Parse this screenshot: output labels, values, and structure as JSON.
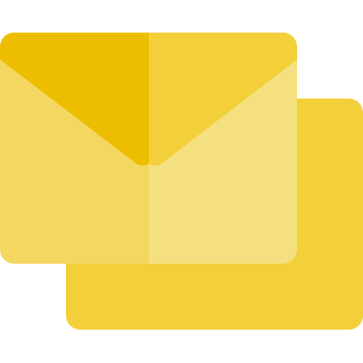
{
  "icon": {
    "name": "mail-envelopes-icon",
    "colors": {
      "back_envelope": "#F3D03A",
      "front_body_left": "#F4D760",
      "front_body_right": "#F4E07E",
      "front_flap_left": "#EDBE00",
      "front_flap_right": "#F3D03A"
    }
  }
}
